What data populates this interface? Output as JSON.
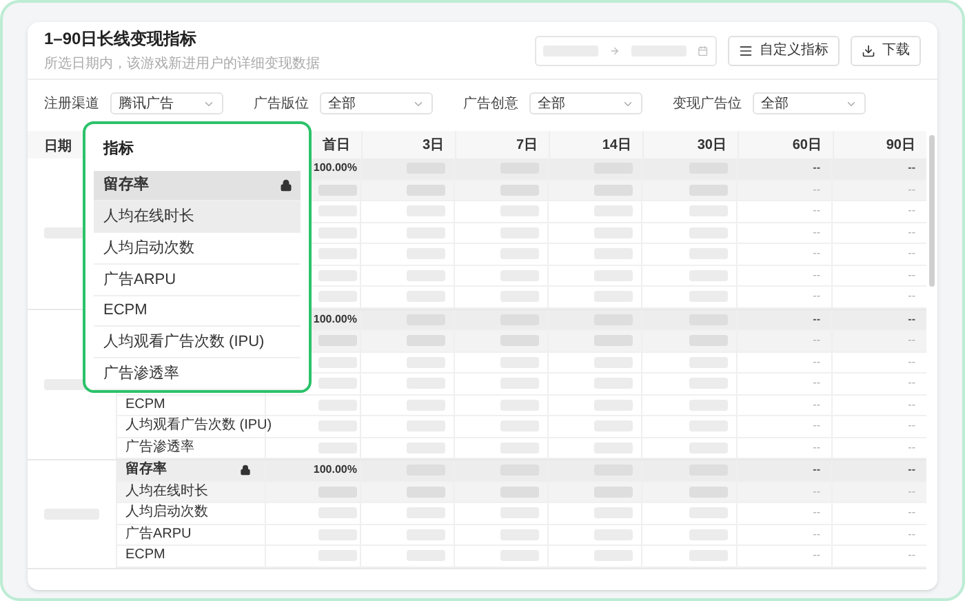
{
  "header": {
    "title": "1–90日长线变现指标",
    "subtitle": "所选日期内，该游戏新进用户的详细变现数据",
    "buttons": [
      {
        "kind": "customize",
        "label": "自定义指标"
      },
      {
        "kind": "download",
        "label": "下载"
      }
    ]
  },
  "filters": [
    {
      "label": "注册渠道",
      "value": "腾讯广告"
    },
    {
      "label": "广告版位",
      "value": "全部"
    },
    {
      "label": "广告创意",
      "value": "全部"
    },
    {
      "label": "变现广告位",
      "value": "全部"
    }
  ],
  "table": {
    "date_column": "日期",
    "value_columns": [
      "首日",
      "3日",
      "7日",
      "14日",
      "30日",
      "60日",
      "90日"
    ],
    "groups": [
      {
        "rows": [
          {
            "kind": "retention",
            "first_day": "100.00%",
            "d60": "--",
            "d90": "--"
          },
          {
            "kind": "metric",
            "shaded": true,
            "d60": "--",
            "d90": "--"
          },
          {
            "kind": "metric",
            "shaded": false,
            "d60": "--",
            "d90": "--"
          },
          {
            "kind": "metric",
            "shaded": false,
            "d60": "--",
            "d90": "--"
          },
          {
            "kind": "metric",
            "shaded": false,
            "d60": "--",
            "d90": "--"
          },
          {
            "kind": "metric",
            "shaded": false,
            "d60": "--",
            "d90": "--"
          },
          {
            "kind": "metric",
            "shaded": false,
            "d60": "--",
            "d90": "--"
          }
        ]
      },
      {
        "rows": [
          {
            "kind": "retention",
            "first_day": "100.00%",
            "d60": "--",
            "d90": "--"
          },
          {
            "kind": "metric",
            "shaded": true,
            "d60": "--",
            "d90": "--"
          },
          {
            "kind": "metric",
            "shaded": false,
            "d60": "--",
            "d90": "--"
          },
          {
            "kind": "metric",
            "shaded": false,
            "d60": "--",
            "d90": "--"
          },
          {
            "kind": "metric",
            "shaded": false,
            "metric": "ECPM",
            "d60": "--",
            "d90": "--"
          },
          {
            "kind": "metric",
            "shaded": false,
            "metric": "人均观看广告次数 (IPU)",
            "d60": "--",
            "d90": "--"
          },
          {
            "kind": "metric",
            "shaded": false,
            "metric": "广告渗透率",
            "d60": "--",
            "d90": "--"
          }
        ]
      },
      {
        "rows": [
          {
            "kind": "retention",
            "metric": "留存率",
            "locked": true,
            "first_day": "100.00%",
            "d60": "--",
            "d90": "--"
          },
          {
            "kind": "metric",
            "shaded": true,
            "metric": "人均在线时长",
            "d60": "--",
            "d90": "--"
          },
          {
            "kind": "metric",
            "shaded": false,
            "metric": "人均启动次数",
            "d60": "--",
            "d90": "--"
          },
          {
            "kind": "metric",
            "shaded": false,
            "metric": "广告ARPU",
            "d60": "--",
            "d90": "--"
          },
          {
            "kind": "metric",
            "shaded": false,
            "metric": "ECPM",
            "d60": "--",
            "d90": "--"
          }
        ]
      }
    ]
  },
  "metric_menu": {
    "title": "指标",
    "items": [
      {
        "label": "留存率",
        "locked": true,
        "highlighted": false
      },
      {
        "label": "人均在线时长",
        "locked": false,
        "highlighted": true
      },
      {
        "label": "人均启动次数",
        "locked": false,
        "highlighted": false
      },
      {
        "label": "广告ARPU",
        "locked": false,
        "highlighted": false
      },
      {
        "label": "ECPM",
        "locked": false,
        "highlighted": false
      },
      {
        "label": "人均观看广告次数 (IPU)",
        "locked": false,
        "highlighted": false
      },
      {
        "label": "广告渗透率",
        "locked": false,
        "highlighted": false
      }
    ]
  }
}
